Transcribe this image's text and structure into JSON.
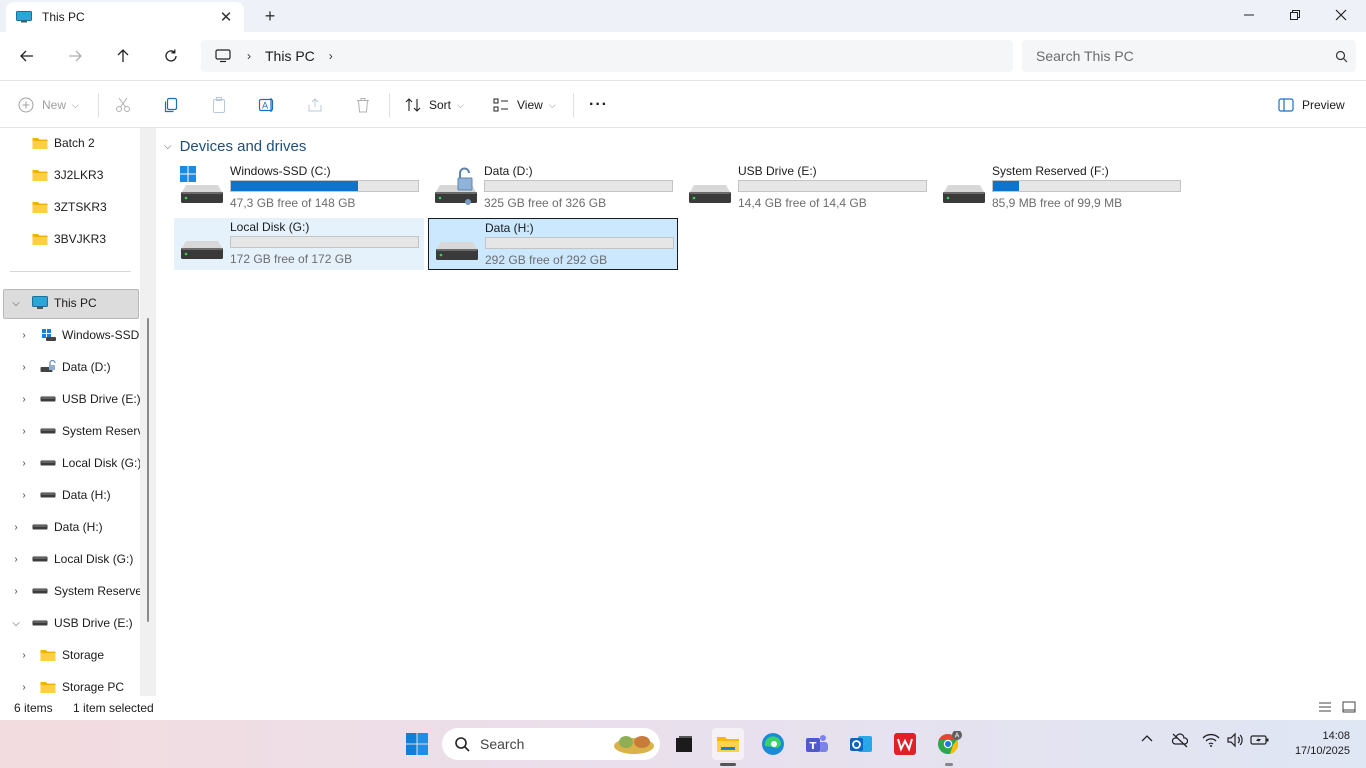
{
  "window": {
    "tab_title": "This PC",
    "new_tab_label": "+",
    "close_tab_label": "✕"
  },
  "nav": {
    "address": [
      "This PC"
    ],
    "search_placeholder": "Search This PC"
  },
  "commands": {
    "new": "New",
    "sort": "Sort",
    "view": "View",
    "more": "···",
    "preview": "Preview"
  },
  "sidebar": {
    "items": [
      {
        "label": "Batch 2",
        "icon": "folder-icon",
        "expander": ""
      },
      {
        "label": "3J2LKR3",
        "icon": "folder-icon",
        "expander": ""
      },
      {
        "label": "3ZTSKR3",
        "icon": "folder-icon",
        "expander": ""
      },
      {
        "label": "3BVJKR3",
        "icon": "folder-icon",
        "expander": ""
      },
      {
        "label": "This PC",
        "icon": "computer-icon",
        "expander": "expanded"
      },
      {
        "label": "Windows-SSD",
        "icon": "windows-drive-icon",
        "expander": "collapsed"
      },
      {
        "label": "Data (D:)",
        "icon": "locked-drive-icon",
        "expander": "collapsed"
      },
      {
        "label": "USB Drive (E:)",
        "icon": "drive-icon",
        "expander": "collapsed"
      },
      {
        "label": "System Reserv",
        "icon": "drive-icon",
        "expander": "collapsed"
      },
      {
        "label": "Local Disk (G:)",
        "icon": "drive-icon",
        "expander": "collapsed"
      },
      {
        "label": "Data (H:)",
        "icon": "drive-icon",
        "expander": "collapsed"
      },
      {
        "label": "Data (H:)",
        "icon": "drive-icon",
        "expander": "collapsed"
      },
      {
        "label": "Local Disk (G:)",
        "icon": "drive-icon",
        "expander": "collapsed"
      },
      {
        "label": "System Reservec",
        "icon": "drive-icon",
        "expander": "collapsed"
      },
      {
        "label": "USB Drive (E:)",
        "icon": "drive-icon",
        "expander": "expanded"
      },
      {
        "label": "Storage",
        "icon": "folder-icon",
        "expander": "collapsed"
      },
      {
        "label": "Storage PC",
        "icon": "folder-icon",
        "expander": "collapsed"
      }
    ]
  },
  "main": {
    "group_title": "Devices and drives",
    "drives": [
      {
        "name": "Windows-SSD (C:)",
        "free_text": "47,3 GB free of 148 GB",
        "used_fraction": 0.68,
        "icon": "windows-drive-icon",
        "state": "normal"
      },
      {
        "name": "Data (D:)",
        "free_text": "325 GB free of 326 GB",
        "used_fraction": 0.0,
        "icon": "locked-drive-icon",
        "state": "normal"
      },
      {
        "name": "USB Drive (E:)",
        "free_text": "14,4 GB free of 14,4 GB",
        "used_fraction": 0.0,
        "icon": "drive-icon",
        "state": "normal"
      },
      {
        "name": "System Reserved (F:)",
        "free_text": "85,9 MB free of 99,9 MB",
        "used_fraction": 0.14,
        "icon": "drive-icon",
        "state": "normal"
      },
      {
        "name": "Local Disk (G:)",
        "free_text": "172 GB free of 172 GB",
        "used_fraction": 0.0,
        "icon": "drive-icon",
        "state": "hover"
      },
      {
        "name": "Data (H:)",
        "free_text": "292 GB free of 292 GB",
        "used_fraction": 0.0,
        "icon": "drive-icon",
        "state": "selected"
      }
    ]
  },
  "status": {
    "item_count": "6 items",
    "selection": "1 item selected"
  },
  "taskbar": {
    "search_label": "Search",
    "time": "14:08",
    "date": "17/10/2025"
  },
  "colors": {
    "accent": "#0a74d1",
    "group_title": "#1f4e79",
    "selection_bg": "#cce8ff",
    "hover_bg": "#e5f1fb"
  }
}
